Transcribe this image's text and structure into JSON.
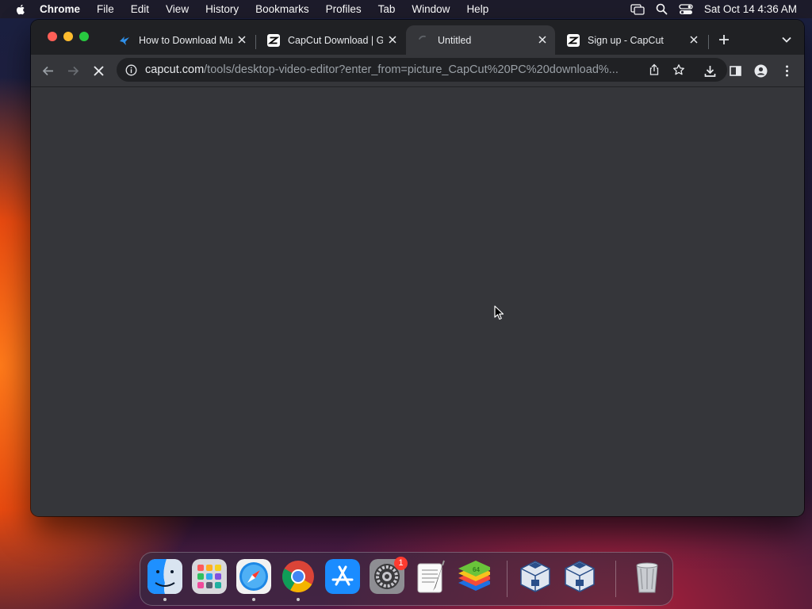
{
  "menubar": {
    "app_name": "Chrome",
    "items": [
      "File",
      "Edit",
      "View",
      "History",
      "Bookmarks",
      "Profiles",
      "Tab",
      "Window",
      "Help"
    ],
    "clock": "Sat Oct 14  4:36 AM",
    "status_icons": [
      "screen-mirroring-icon",
      "spotlight-search-icon",
      "control-center-icon"
    ]
  },
  "browser": {
    "tabs": [
      {
        "title": "How to Download Mu",
        "favicon": "blue-bird-favicon",
        "active": false
      },
      {
        "title": "CapCut Download | G",
        "favicon": "capcut-favicon",
        "active": false
      },
      {
        "title": "Untitled",
        "favicon": "loading-spinner",
        "active": true
      },
      {
        "title": "Sign up - CapCut",
        "favicon": "capcut-favicon",
        "active": false
      }
    ],
    "url_host": "capcut.com",
    "url_path": "/tools/desktop-video-editor?enter_from=picture_CapCut%20PC%20download%...",
    "loading": true
  },
  "dock": {
    "apps": [
      "Finder",
      "Launchpad",
      "Safari",
      "Google Chrome",
      "App Store",
      "System Settings",
      "TextEdit",
      "BlueStacks",
      "VirtualBox",
      "VirtualBox",
      "Trash"
    ],
    "settings_badge": "1"
  },
  "colors": {
    "window_bg": "#35363a",
    "tabstrip_bg": "#202124",
    "omnibox_bg": "#202124",
    "text": "#e8eaed",
    "badge": "#ff3b30"
  }
}
